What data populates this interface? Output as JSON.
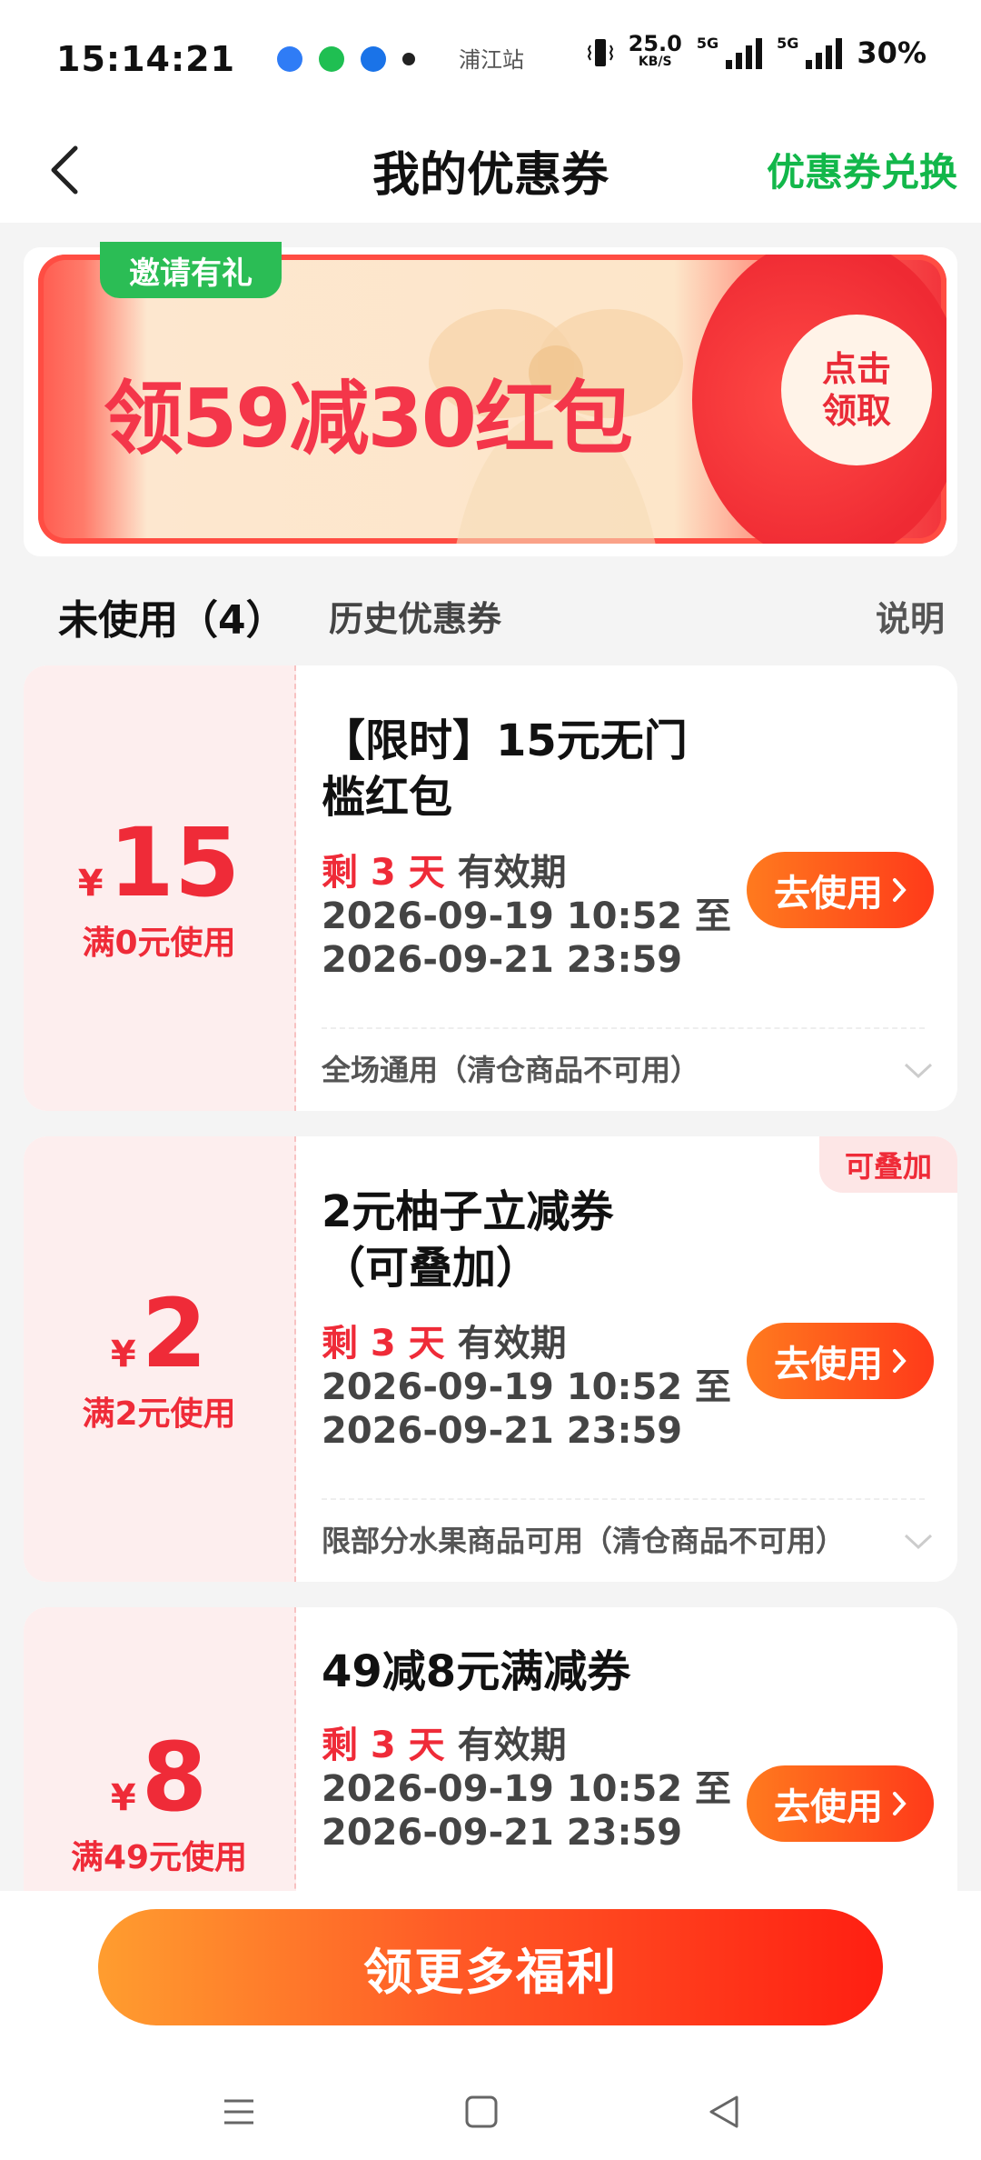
{
  "status_bar": {
    "time": "15:14:21",
    "carrier_text": "浦江站",
    "speed_value": "25.0",
    "speed_unit": "KB/S",
    "net1": "5G",
    "net2": "5G",
    "battery": "30%"
  },
  "nav": {
    "title": "我的优惠券",
    "action": "优惠券兑换",
    "action_color": "#12b74a"
  },
  "banner": {
    "tag": "邀请有礼",
    "text": "领59减30红包",
    "button_line1": "点击",
    "button_line2": "领取"
  },
  "tabs": {
    "active": "未使用（4）",
    "history": "历史优惠券",
    "explain": "说明"
  },
  "coupons": [
    {
      "yen": "¥",
      "amount": "15",
      "threshold": "满0元使用",
      "title_line1": "【限时】15元无门",
      "title_line2": "槛红包",
      "remain": "剩 3 天",
      "validity_label": "有效期",
      "start": "2026-09-19 10:52 至",
      "end": "2026-09-21 23:59",
      "button": "去使用",
      "scope": "全场通用（清仓商品不可用）"
    },
    {
      "yen": "¥",
      "amount": "2",
      "threshold": "满2元使用",
      "badge": "可叠加",
      "title_line1": "2元柚子立减券",
      "title_line2": "（可叠加）",
      "remain": "剩 3 天",
      "validity_label": "有效期",
      "start": "2026-09-19 10:52 至",
      "end": "2026-09-21 23:59",
      "button": "去使用",
      "scope": "限部分水果商品可用（清仓商品不可用）"
    },
    {
      "yen": "¥",
      "amount": "8",
      "threshold": "满49元使用",
      "title_line1": "49减8元满减券",
      "remain": "剩 3 天",
      "validity_label": "有效期",
      "start": "2026-09-19 10:52 至",
      "end": "2026-09-21 23:59",
      "button": "去使用"
    }
  ],
  "cta": {
    "label": "领更多福利"
  },
  "colors": {
    "accent_red": "#ef2b38",
    "accent_green": "#12b74a",
    "button_orange": "#ff5a26"
  },
  "icons": [
    "back-arrow-icon",
    "chevron-right-icon",
    "chevron-down-icon",
    "menu-icon",
    "home-square-icon",
    "back-triangle-icon"
  ]
}
